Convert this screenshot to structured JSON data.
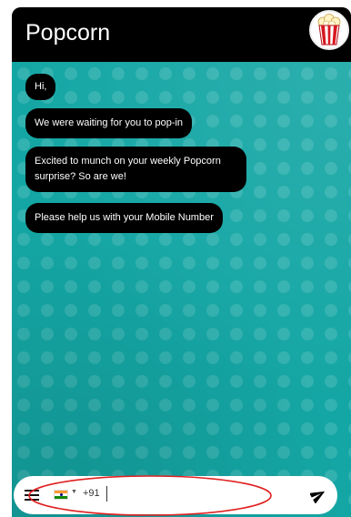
{
  "header": {
    "title": "Popcorn",
    "logo_icon": "popcorn-bucket-icon"
  },
  "messages": [
    "Hi,",
    "We were waiting for you to pop-in",
    "Excited to munch on your weekly Popcorn surprise? So are we!",
    "Please help us with your Mobile Number"
  ],
  "input_bar": {
    "menu_icon": "hamburger-menu-icon",
    "country_flag": "india-flag-icon",
    "dial_code": "+91",
    "phone_value": "",
    "send_icon": "paper-plane-icon"
  },
  "colors": {
    "chat_background": "#14a6a4",
    "header_background": "#000000",
    "bubble_background": "#000000",
    "bubble_text": "#ffffff",
    "annotation_outline": "#e02020"
  }
}
